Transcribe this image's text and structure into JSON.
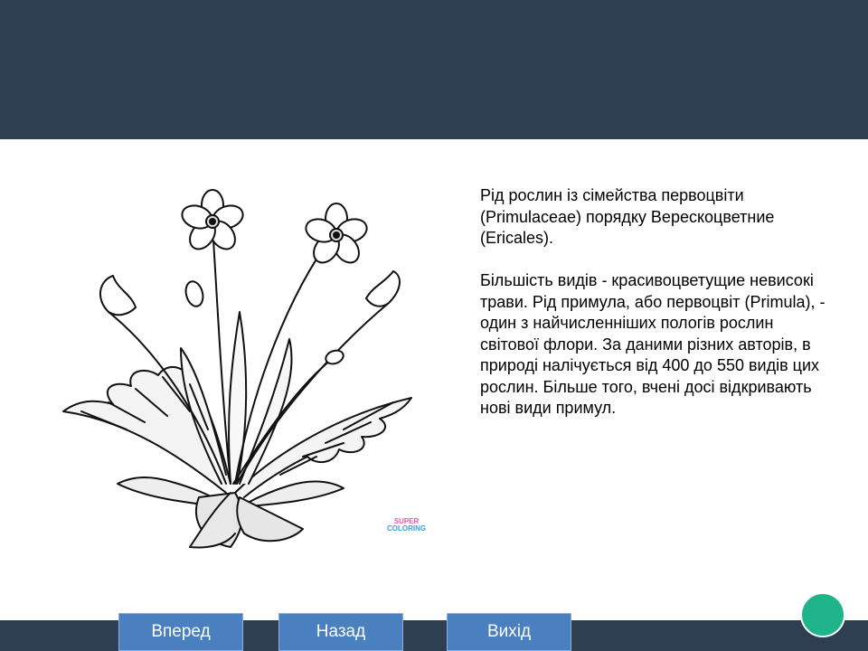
{
  "content": {
    "paragraph_1": "Рід рослин із сімейства первоцвіти (Primulaceae) порядку Верескоцветние (Ericales).",
    "paragraph_2": "Більшість видів - красивоцветущие невисокі трави. Рід примула, або первоцвіт (Primula), - один з найчисленніших пологів рослин світової флори. За даними різних авторів, в природі налічується від 400 до 550 видів цих рослин. Більше того, вчені досі відкривають нові види примул."
  },
  "illustration": {
    "watermark_line_1": "SUPER",
    "watermark_line_2": "COLORING"
  },
  "nav": {
    "forward_label": "Вперед",
    "back_label": "Назад",
    "exit_label": "Вихід"
  },
  "colors": {
    "bar": "#2f3f52",
    "button": "#4a7fc0",
    "circle": "#1fb48a"
  }
}
